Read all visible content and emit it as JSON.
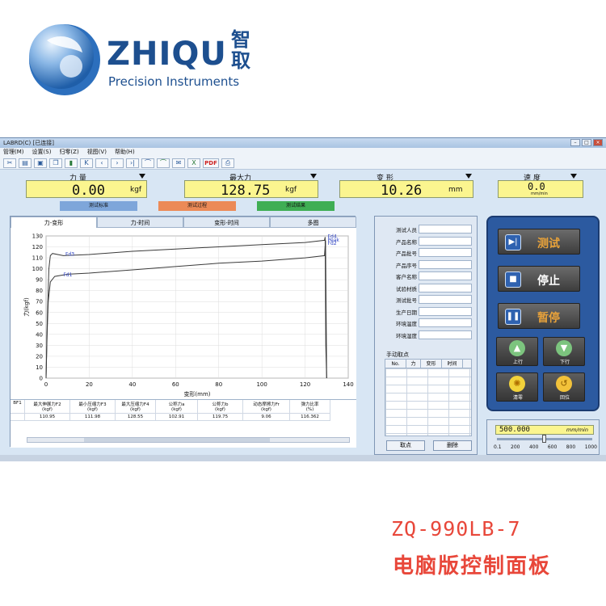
{
  "brand": {
    "name": "ZHIQU",
    "chinese": "智取",
    "subtitle": "Precision Instruments"
  },
  "window": {
    "title": "LABRD(C)  [已连接]",
    "menu": [
      "管理(M)",
      "设置(S)",
      "归零(Z)",
      "视图(V)",
      "帮助(H)"
    ],
    "toolbar_icons": [
      "cut-icon",
      "open-icon",
      "save-icon",
      "copy-icon",
      "delete-icon",
      "first-icon",
      "prev-icon",
      "next-icon",
      "last-icon",
      "curve-icon",
      "curve-fit-icon",
      "mail-icon",
      "excel-icon",
      "pdf-icon",
      "print-icon"
    ],
    "pdf_label": "PDF"
  },
  "readouts": {
    "force": {
      "label": "力  量",
      "value": "0.00",
      "unit": "kgf"
    },
    "max_force": {
      "label": "最大力",
      "value": "128.75",
      "unit": "kgf"
    },
    "deformation": {
      "label": "变  形",
      "value": "10.26",
      "unit": "mm"
    },
    "speed": {
      "label": "速  度",
      "value": "0.0",
      "unit": "mm/min"
    }
  },
  "process_tabs": [
    {
      "label": "测试标准",
      "color": "#7ea6da"
    },
    {
      "label": "测试过程",
      "color": "#ec8a57"
    },
    {
      "label": "测试结果",
      "color": "#3fae54"
    }
  ],
  "chart_tabs": [
    "力-变形",
    "力-时间",
    "变形-时间",
    "多图"
  ],
  "chart_data": {
    "type": "line",
    "xlabel": "变形(mm)",
    "ylabel": "力(kgf)",
    "xlim": [
      0,
      140
    ],
    "ylim": [
      0,
      130
    ],
    "xticks": [
      0,
      20,
      40,
      60,
      80,
      100,
      120,
      140
    ],
    "yticks": [
      0,
      10,
      20,
      30,
      40,
      50,
      60,
      70,
      80,
      90,
      100,
      110,
      120,
      130
    ],
    "series": [
      {
        "color": "#3a3a3a",
        "x": [
          0,
          0.6,
          1.3,
          2,
          3,
          8,
          20,
          40,
          60,
          80,
          100,
          120,
          129,
          129.3,
          129.6,
          130
        ],
        "y": [
          0,
          55,
          100,
          112,
          114,
          112,
          113,
          116,
          118,
          120,
          122,
          124,
          126,
          129,
          30,
          0
        ]
      },
      {
        "color": "#3a3a3a",
        "x": [
          0,
          0.5,
          1,
          2,
          4,
          10,
          20,
          40,
          60,
          80,
          100,
          120,
          129,
          129.5,
          130
        ],
        "y": [
          0,
          40,
          70,
          88,
          93,
          95,
          96,
          99,
          102,
          105,
          107,
          110,
          112,
          126,
          0
        ]
      }
    ],
    "annotations": [
      {
        "text": "Fd3",
        "x": 9,
        "y": 112
      },
      {
        "text": "Fd1",
        "x": 8,
        "y": 93
      },
      {
        "text": "Fd4",
        "x": 130.5,
        "y": 128
      },
      {
        "text": "Peak",
        "x": 130.5,
        "y": 125
      },
      {
        "text": "Fd2",
        "x": 130.5,
        "y": 122
      }
    ]
  },
  "results_table": {
    "headers": [
      [
        "BF1",
        ""
      ],
      [
        "最大伸展力F2",
        "(kgf)"
      ],
      [
        "最小压缩力F3",
        "(kgf)"
      ],
      [
        "最大压缩力F4",
        "(kgf)"
      ],
      [
        "公称力a",
        "(kgf)"
      ],
      [
        "公称力b",
        "(kgf)"
      ],
      [
        "动态摩擦力Fr",
        "(kgf)"
      ],
      [
        "弹力比率",
        "(%)"
      ]
    ],
    "row": [
      "",
      "110.95",
      "111.98",
      "128.55",
      "102.91",
      "119.75",
      "9.06",
      "116.362"
    ]
  },
  "info_fields": [
    "测试人员",
    "产品名称",
    "产品批号",
    "产品序号",
    "客户名称",
    "试验材质",
    "测试批号",
    "生产日期",
    "环境温度",
    "环境湿度"
  ],
  "manual_points": {
    "title": "手动取点",
    "columns": [
      "No.",
      "力",
      "变形",
      "时间"
    ],
    "pick_button": "取点",
    "delete_button": "删除"
  },
  "controls": {
    "test": "测试",
    "stop": "停止",
    "pause": "暂停",
    "up": "上行",
    "down": "下行",
    "zero": "清零",
    "return": "回位"
  },
  "speed_setting": {
    "value": "500.000",
    "unit": "mm/min",
    "ticks": [
      "0.1",
      "200",
      "400",
      "600",
      "800",
      "1000"
    ],
    "level": 0.5
  },
  "footer": {
    "model": "ZQ-990LB-7",
    "description": "电脑版控制面板"
  }
}
